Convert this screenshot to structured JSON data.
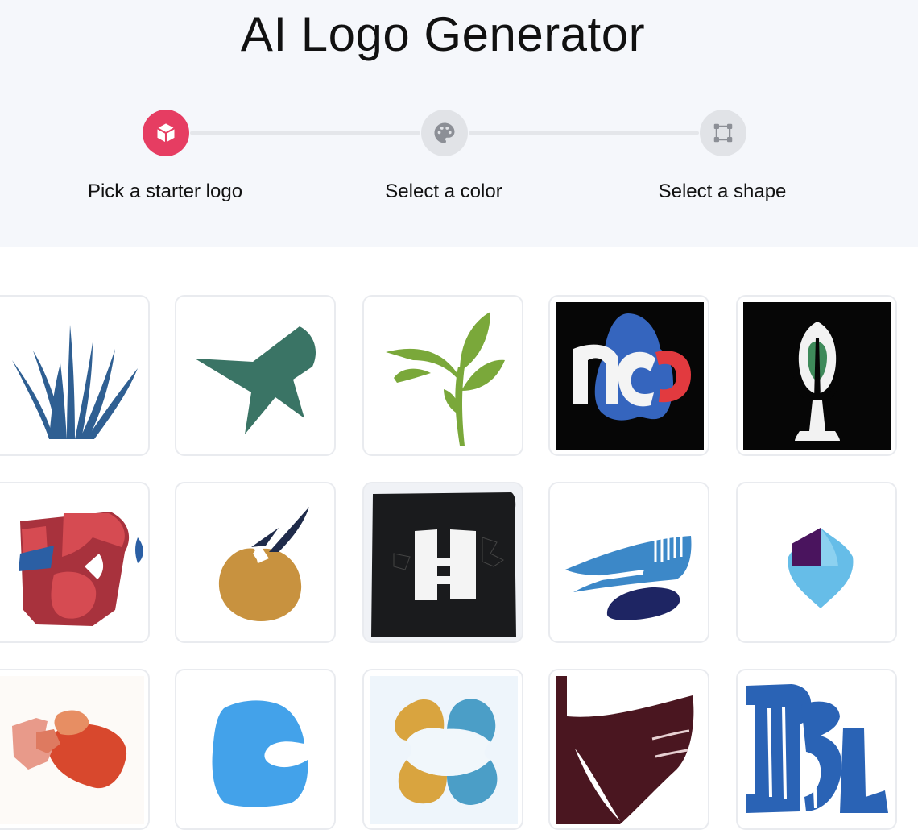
{
  "page": {
    "title": "AI Logo Generator"
  },
  "steps": [
    {
      "label": "Pick a starter logo",
      "icon": "cube-icon",
      "active": true
    },
    {
      "label": "Select a color",
      "icon": "palette-icon",
      "active": false
    },
    {
      "label": "Select a shape",
      "icon": "shape-icon",
      "active": false
    }
  ],
  "colors": {
    "accent": "#e63d62",
    "inactive_step": "#e1e3e7",
    "header_bg": "#f5f7fb"
  },
  "logos": [
    {
      "name": "blue-grass-logo"
    },
    {
      "name": "green-star-logo"
    },
    {
      "name": "green-sprout-logo"
    },
    {
      "name": "mc-monogram-logo"
    },
    {
      "name": "microphone-logo"
    },
    {
      "name": "red-abstract-logo"
    },
    {
      "name": "orange-bird-logo"
    },
    {
      "name": "h-block-logo"
    },
    {
      "name": "blue-wave-logo"
    },
    {
      "name": "purple-droplet-logo"
    },
    {
      "name": "coral-blob-logo"
    },
    {
      "name": "blue-c-logo"
    },
    {
      "name": "four-petal-logo"
    },
    {
      "name": "maroon-shape-logo"
    },
    {
      "name": "blue-letters-logo"
    }
  ]
}
